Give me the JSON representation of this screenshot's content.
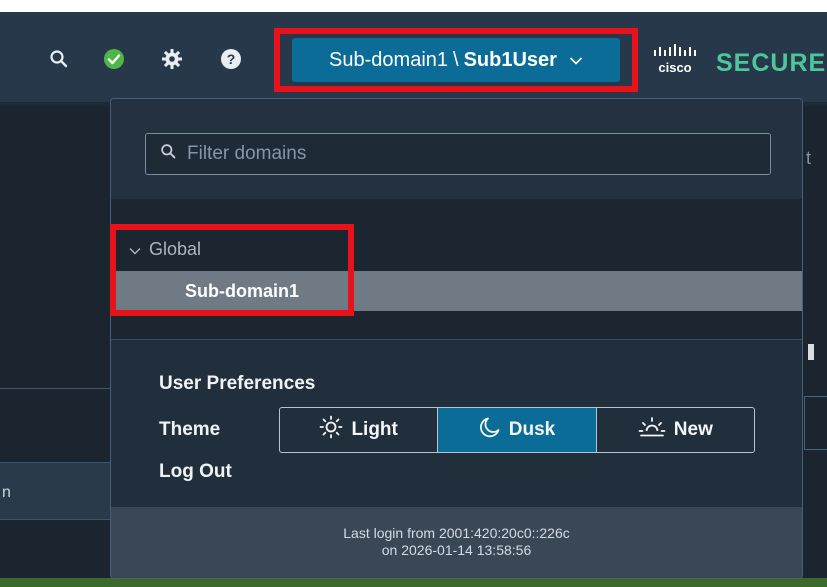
{
  "header": {
    "domain": "Sub-domain1",
    "separator": "\\",
    "user": "Sub1User",
    "brand_text": "SECURE",
    "brand_logo": "cisco",
    "icons": [
      "search-icon",
      "status-check-icon",
      "gear-icon",
      "help-icon"
    ],
    "status_color": "#4fb648",
    "accent_color": "#0b6c97"
  },
  "domain_dropdown": {
    "filter_placeholder": "Filter domains",
    "tree": {
      "parent": "Global",
      "child": "Sub-domain1"
    },
    "preferences_label": "User Preferences",
    "theme_label": "Theme",
    "themes": [
      {
        "label": "Light",
        "icon": "sun-icon",
        "active": false
      },
      {
        "label": "Dusk",
        "icon": "moon-icon",
        "active": true
      },
      {
        "label": "New",
        "icon": "sunrise-icon",
        "active": false
      }
    ],
    "logout_label": "Log Out",
    "last_login_line1": "Last login from 2001:420:20c0::226c",
    "last_login_line2": "on 2026-01-14 13:58:56"
  },
  "highlight_color": "#e8121a"
}
